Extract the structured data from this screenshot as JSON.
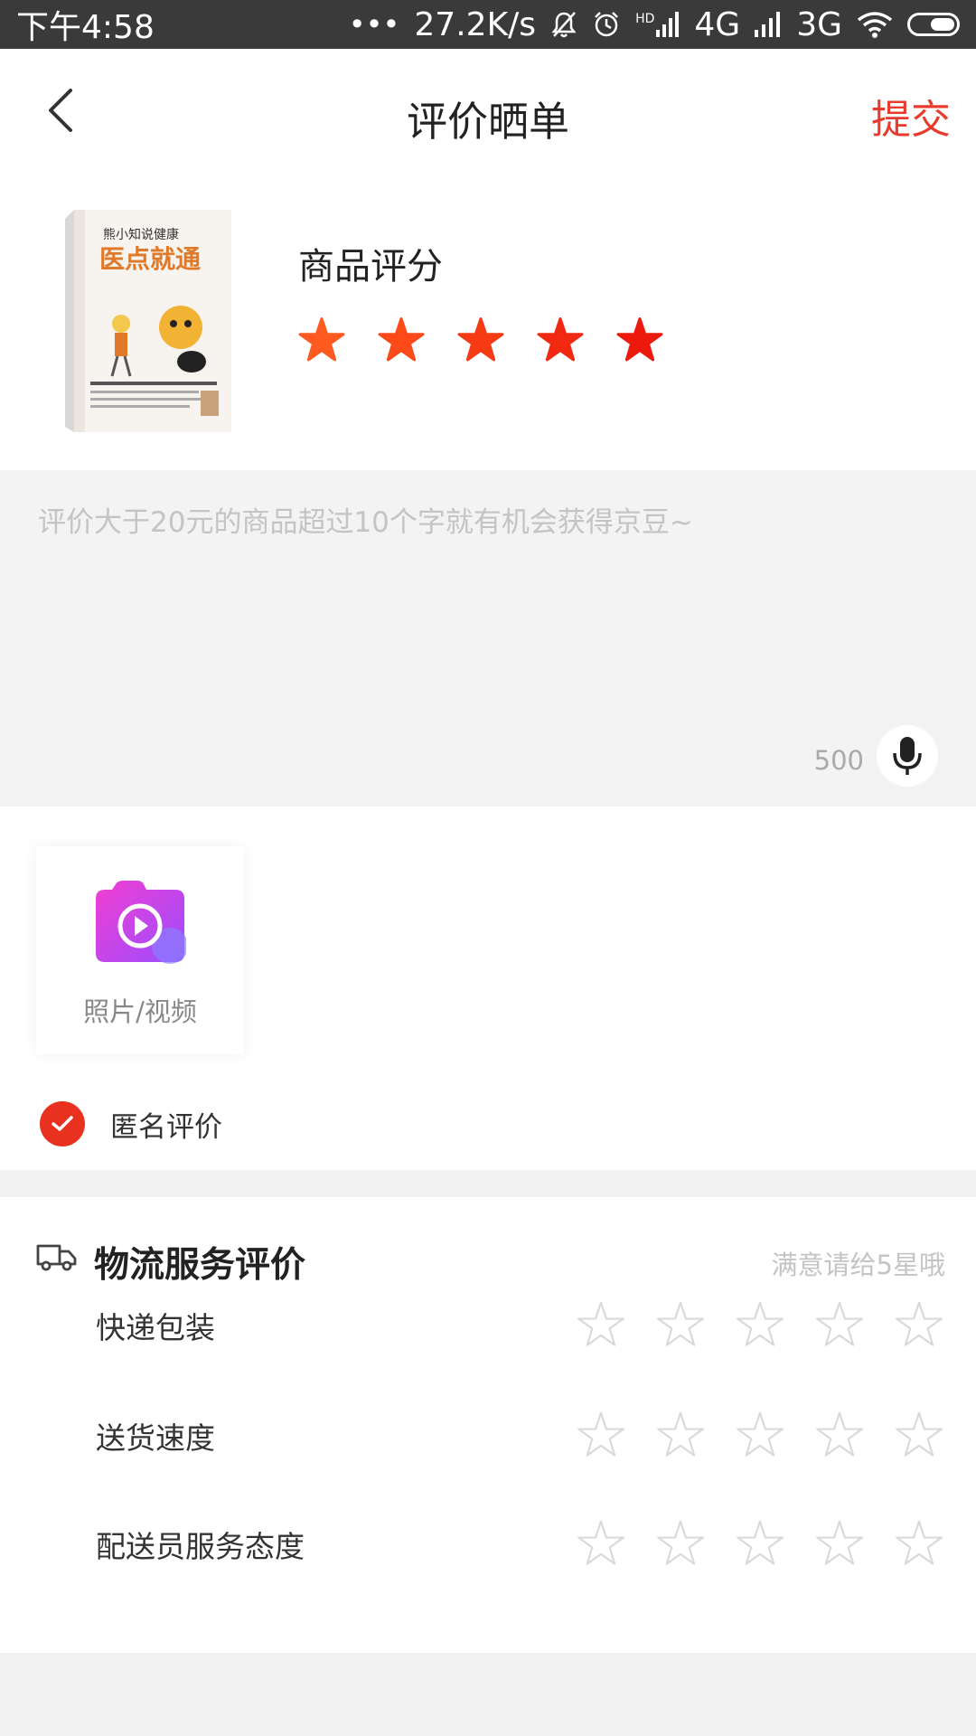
{
  "status_bar": {
    "time": "下午4:58",
    "dots": "•••",
    "net_speed": "27.2K/s",
    "icons": [
      "mute-bell-icon",
      "alarm-icon",
      "hd-signal-icon",
      "signal-4g-icon",
      "signal-3g-icon",
      "wifi-icon",
      "battery-icon"
    ],
    "hd": "HD",
    "network1": "4G",
    "network2": "3G"
  },
  "header": {
    "title": "评价晒单",
    "submit_label": "提交",
    "back_icon": "chevron-left-icon"
  },
  "product": {
    "image_title": "熊小知说健康",
    "image_subtitle": "医点就通",
    "rating_label": "商品评分",
    "rating": 5,
    "rating_max": 5,
    "star_colors": [
      "#ff5a1f",
      "#fb4a18",
      "#f53a14",
      "#f02910",
      "#eb1a0c"
    ]
  },
  "review": {
    "placeholder": "评价大于20元的商品超过10个字就有机会获得京豆~",
    "value": "",
    "char_count": "500",
    "mic_icon": "microphone-icon"
  },
  "media": {
    "label": "照片/视频",
    "icon": "camera-video-icon"
  },
  "anonymous": {
    "label": "匿名评价",
    "checked": true
  },
  "logistics": {
    "icon": "truck-icon",
    "title": "物流服务评价",
    "hint": "满意请给5星哦",
    "rows": [
      {
        "label": "快递包装",
        "rating": 0,
        "rating_max": 5
      },
      {
        "label": "送货速度",
        "rating": 0,
        "rating_max": 5
      },
      {
        "label": "配送员服务态度",
        "rating": 0,
        "rating_max": 5
      }
    ]
  },
  "colors": {
    "accent": "#e93b2d",
    "check": "#e8311e",
    "empty_star": "#d9d9d9"
  }
}
